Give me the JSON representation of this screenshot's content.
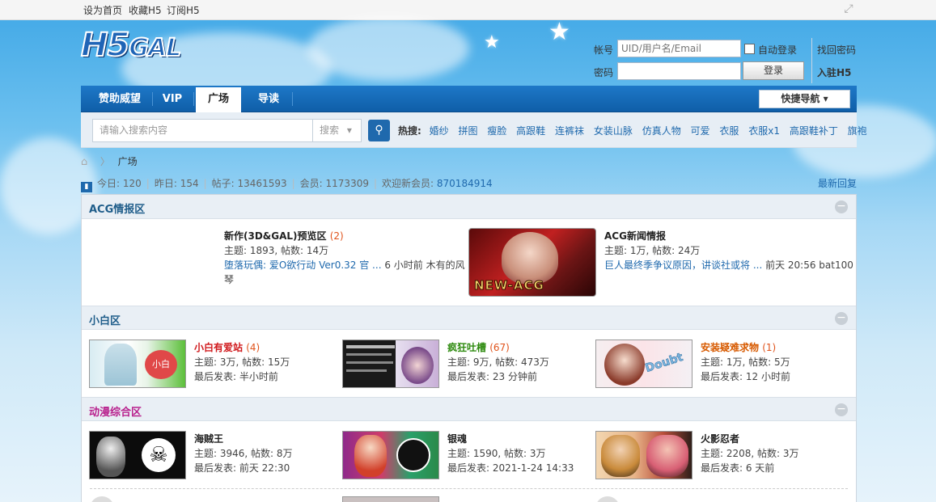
{
  "topbar": {
    "links": [
      "设为首页",
      "收藏H5",
      "订阅H5"
    ]
  },
  "logo": {
    "main": "H5",
    "rest": "GAL"
  },
  "login": {
    "account_label": "帐号",
    "account_placeholder": "UID/用户名/Email",
    "auto_login": "自动登录",
    "find_password": "找回密码",
    "password_label": "密码",
    "login_button": "登录",
    "register": "入驻H5"
  },
  "nav": {
    "items": [
      "赞助威望",
      "VIP",
      "广场",
      "导读"
    ],
    "active": "广场",
    "quick_nav": "快捷导航"
  },
  "search": {
    "placeholder": "请输入搜索内容",
    "scope": "搜索",
    "hot_label": "热搜:",
    "hot": [
      "婚纱",
      "拼图",
      "瘦脸",
      "高跟鞋",
      "连裤袜",
      "女装山脉",
      "仿真人物",
      "可爱",
      "衣服",
      "衣服x1",
      "高跟鞋补丁",
      "旗袍"
    ]
  },
  "breadcrumb": {
    "current": "广场"
  },
  "stats": {
    "today_label": "今日:",
    "today": "120",
    "yesterday_label": "昨日:",
    "yesterday": "154",
    "posts_label": "帖子:",
    "posts": "13461593",
    "members_label": "会员:",
    "members": "1173309",
    "welcome_label": "欢迎新会员:",
    "welcome": "870184914",
    "recent": "最新回复"
  },
  "sections": [
    {
      "title": "ACG情报区",
      "forums": [
        {
          "name": "新作(3D&GAL)预览区",
          "count": "(2)",
          "meta": "主题: 1893, 帖数: 14万",
          "last_link": "堕落玩偶: 爱O欲行动 Ver0.32 官 ...",
          "last_info": " 6 小时前 木有的风",
          "last_info2": "琴"
        },
        {
          "name": "ACG新闻情报",
          "meta": "主题: 1万, 帖数: 24万",
          "last_link": "巨人最终季争议原因，讲谈社或将 ...",
          "last_info": " 前天 20:56 bat100",
          "thumb_text": "NEW-ACG"
        }
      ]
    },
    {
      "title": "小白区",
      "forums": [
        {
          "name": "小白有爱站",
          "count": "(4)",
          "meta": "主题: 3万, 帖数: 15万",
          "last": "最后发表: 半小时前",
          "thumb_text": "小白"
        },
        {
          "name": "疯狂吐槽",
          "count": "(67)",
          "meta": "主题: 9万, 帖数: 473万",
          "last": "最后发表: 23 分钟前"
        },
        {
          "name": "安装疑难求物",
          "count": "(1)",
          "meta": "主题: 1万, 帖数: 5万",
          "last": "最后发表: 12 小时前",
          "thumb_text": "Doubt"
        }
      ]
    },
    {
      "title": "动漫综合区",
      "forums": [
        {
          "name": "海贼王",
          "meta": "主题: 3946, 帖数: 8万",
          "last": "最后发表: 前天 22:30"
        },
        {
          "name": "银魂",
          "meta": "主题: 1590, 帖数: 3万",
          "last": "最后发表: 2021-1-24 14:33"
        },
        {
          "name": "火影忍者",
          "meta": "主题: 2208, 帖数: 3万",
          "last": "最后发表: 6 天前"
        }
      ]
    }
  ],
  "colors": {
    "nav_bg": "#1468b6",
    "link": "#1f69ad",
    "count": "#e0531b",
    "section_acg": "#1f5d8a",
    "section_white": "#1f5d8a",
    "section_anime": "#b81f8c"
  }
}
